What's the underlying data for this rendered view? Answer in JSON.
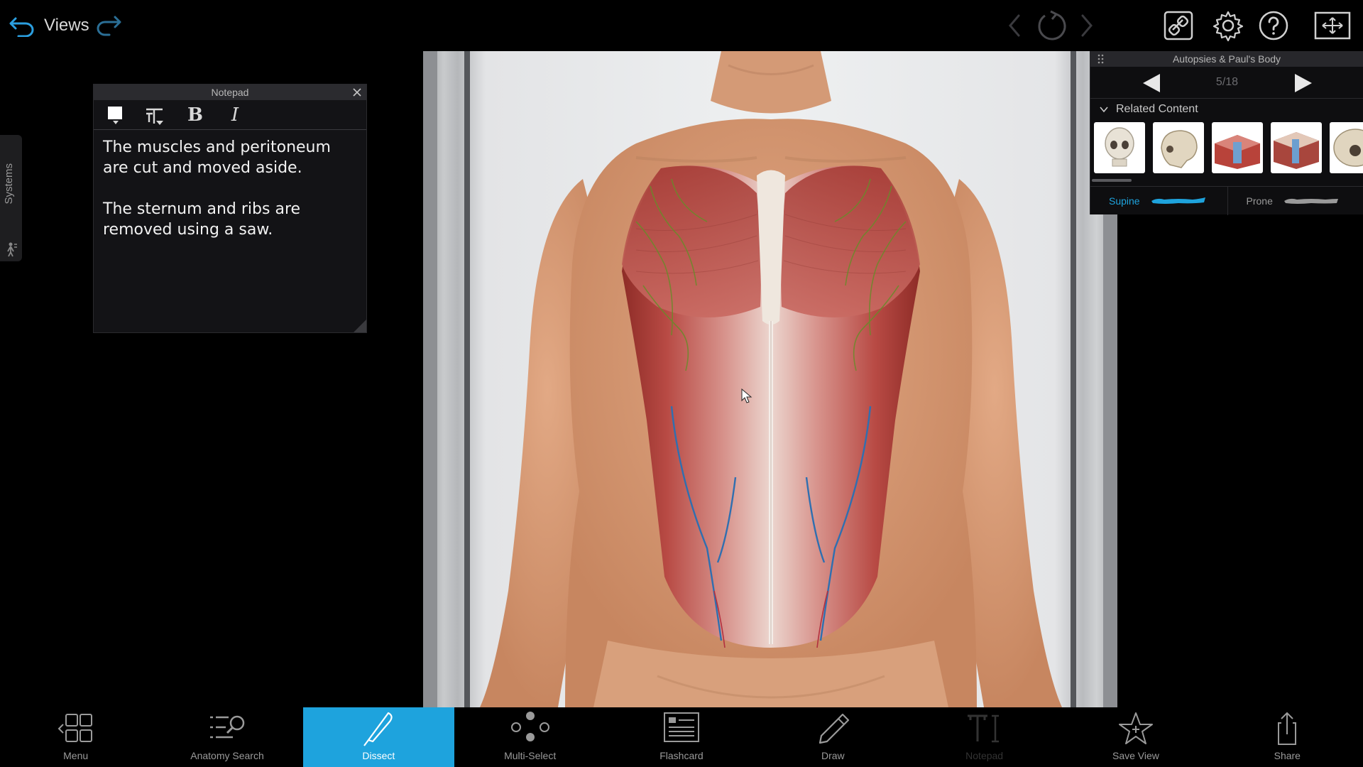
{
  "topbar": {
    "views_label": "Views"
  },
  "systems_tab": {
    "label": "Systems"
  },
  "notepad": {
    "title": "Notepad",
    "paragraphs": [
      "The muscles and peritoneum are cut and moved aside.",
      "The sternum and ribs are removed using a saw."
    ]
  },
  "right_panel": {
    "title": "Autopsies & Paul's Body",
    "page": "5/18",
    "related_label": "Related Content",
    "thumbnails": [
      "skull-front-thumbnail",
      "skull-side-thumbnail",
      "tissue-section-thumbnail",
      "spine-section-thumbnail",
      "skull-base-thumbnail"
    ],
    "views": [
      {
        "label": "Supine",
        "active": true
      },
      {
        "label": "Prone",
        "active": false
      }
    ]
  },
  "bottom_toolbar": {
    "items": [
      {
        "label": "Menu",
        "icon": "menu-grid-icon"
      },
      {
        "label": "Anatomy Search",
        "icon": "anatomy-search-icon"
      },
      {
        "label": "Dissect",
        "icon": "scalpel-icon",
        "active": true
      },
      {
        "label": "Multi-Select",
        "icon": "multi-select-icon"
      },
      {
        "label": "Flashcard",
        "icon": "flashcard-icon"
      },
      {
        "label": "Draw",
        "icon": "pencil-icon"
      },
      {
        "label": "Notepad",
        "icon": "notepad-icon",
        "disabled": true
      },
      {
        "label": "Save View",
        "icon": "star-icon"
      },
      {
        "label": "Share",
        "icon": "share-icon"
      }
    ]
  },
  "colors": {
    "accent": "#1ea3dd",
    "panel_bg": "#131316",
    "muscle": "#b24a44",
    "skin": "#d9a078"
  }
}
